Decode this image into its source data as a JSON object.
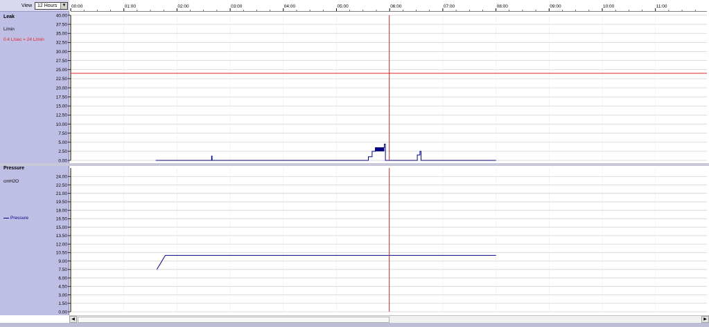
{
  "toolbar": {
    "view_label": "View",
    "view_value": "12 Hours"
  },
  "colors": {
    "panel": "#bfbfe6",
    "line": "#000080",
    "threshold": "#e02020",
    "cursor": "#c03030",
    "grid": "#d0d0d0"
  },
  "chart_data": [
    {
      "type": "line",
      "title": "Leak",
      "ylabel": "L/min",
      "annotation": "0.4 L/sec = 24 L/min",
      "threshold": 24,
      "ylim": [
        0,
        40
      ],
      "y_ticks": [
        "0.00",
        "2.50",
        "5.00",
        "7.50",
        "10.00",
        "12.50",
        "15.00",
        "17.50",
        "20.00",
        "22.50",
        "25.00",
        "27.50",
        "30.00",
        "32.50",
        "35.00",
        "37.50",
        "40.00"
      ],
      "x_ticks": [
        "00:00",
        "01:00",
        "02:00",
        "03:00",
        "04:00",
        "05:00",
        "06:00",
        "07:00",
        "08:00",
        "09:00",
        "10:00",
        "11:00"
      ],
      "xlim_hours": [
        0,
        12
      ],
      "cursor_hours": 6.0,
      "series": [
        {
          "x": [
            1.6,
            2.65,
            2.65,
            2.66,
            2.66,
            5.6,
            5.6,
            5.67,
            5.67,
            5.73,
            5.73,
            5.9,
            5.9,
            5.92,
            5.92,
            6.52,
            6.52,
            6.57,
            6.57,
            6.59,
            6.59,
            8.0
          ],
          "y": [
            0,
            0,
            1.2,
            1.2,
            0,
            0,
            1,
            1,
            2.5,
            2.5,
            3.5,
            3.5,
            4.5,
            4.5,
            0,
            0,
            1.5,
            1.5,
            2.5,
            2.5,
            0,
            0
          ]
        }
      ]
    },
    {
      "type": "line",
      "title": "Pressure",
      "ylabel": "cmH2O",
      "ylim": [
        0,
        25.5
      ],
      "y_ticks": [
        "0.00",
        "1.50",
        "3.00",
        "4.50",
        "6.00",
        "7.50",
        "9.00",
        "10.50",
        "12.00",
        "13.50",
        "15.00",
        "16.50",
        "18.00",
        "19.50",
        "21.00",
        "22.50",
        "24.00"
      ],
      "legend": [
        "Pressure"
      ],
      "xlim_hours": [
        0,
        12
      ],
      "cursor_hours": 6.0,
      "series": [
        {
          "name": "Pressure",
          "x": [
            1.62,
            1.78,
            8.0
          ],
          "y": [
            7.5,
            10,
            10
          ]
        }
      ]
    }
  ]
}
